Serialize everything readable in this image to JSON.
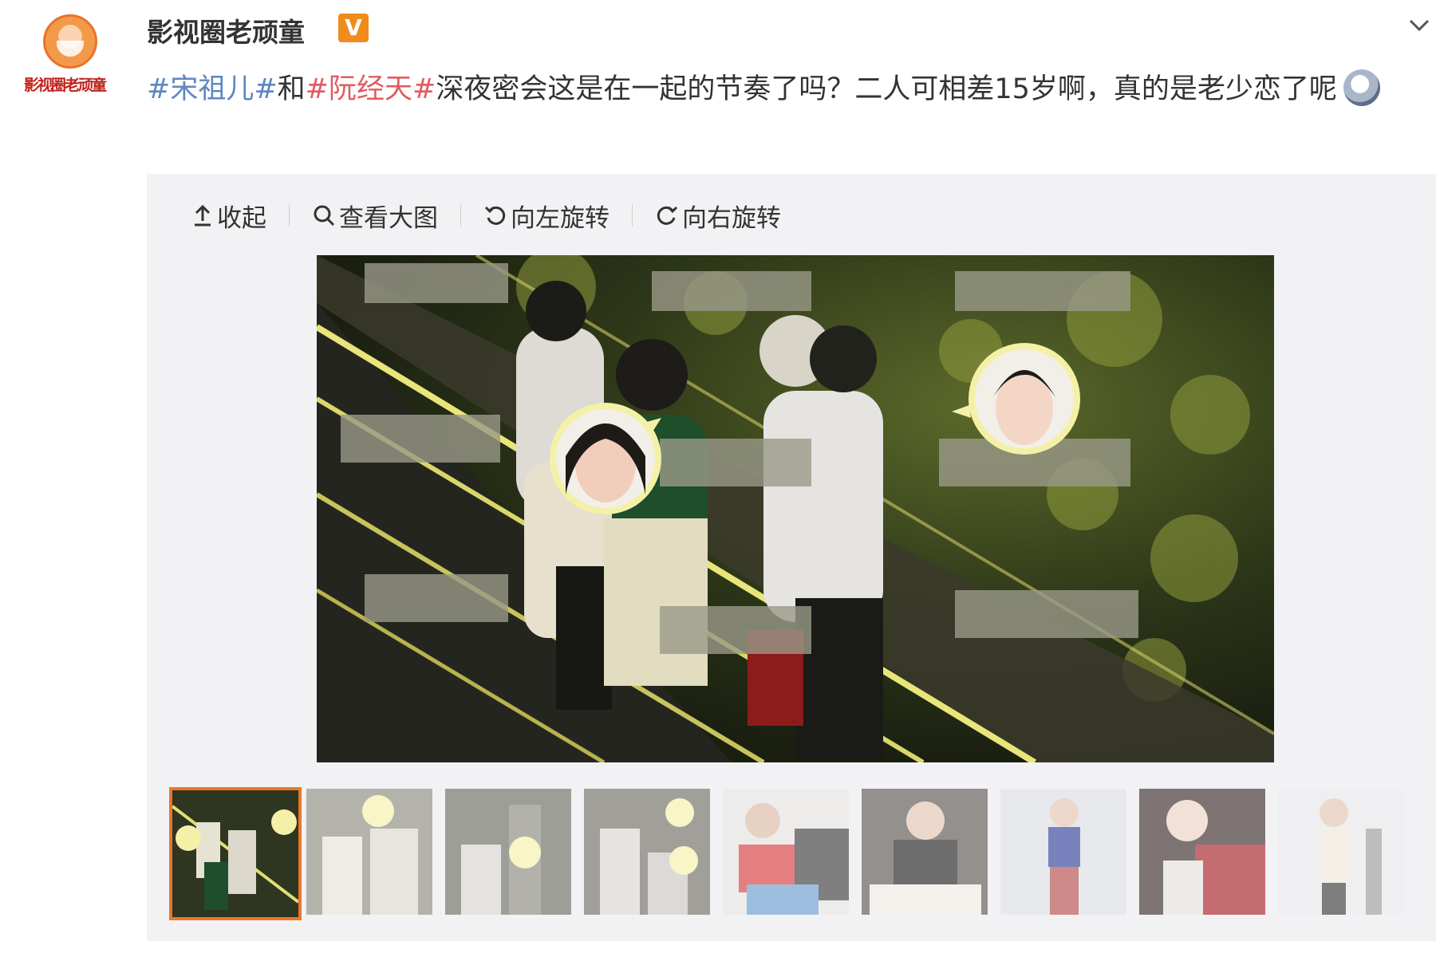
{
  "author": {
    "name": "影视圈老顽童",
    "avatar_text": "影视圈老顽童",
    "verified_badge": "V"
  },
  "post": {
    "topic1": "#宋祖儿#",
    "connector": "和",
    "topic2": "#阮经天#",
    "text": "深夜密会这是在一起的节奏了吗？二人可相差15岁啊，真的是老少恋了呢",
    "emoji": "doge-emoji"
  },
  "toolbar": {
    "collapse": "收起",
    "view_large": "查看大图",
    "rotate_left": "向左旋转",
    "rotate_right": "向右旋转"
  },
  "icons": {
    "menu": "chevron-down-icon",
    "collapse": "upload-arrow-icon",
    "view_large": "search-icon",
    "rotate_left": "rotate-left-icon",
    "rotate_right": "rotate-right-icon"
  },
  "thumbnails": {
    "count": 9,
    "active_index": 0
  },
  "colors": {
    "topic_blue": "#5e86c1",
    "topic_red": "#e05b60",
    "badge_orange": "#f08b1c",
    "active_border": "#e8772c",
    "panel_bg": "#f2f2f5"
  }
}
